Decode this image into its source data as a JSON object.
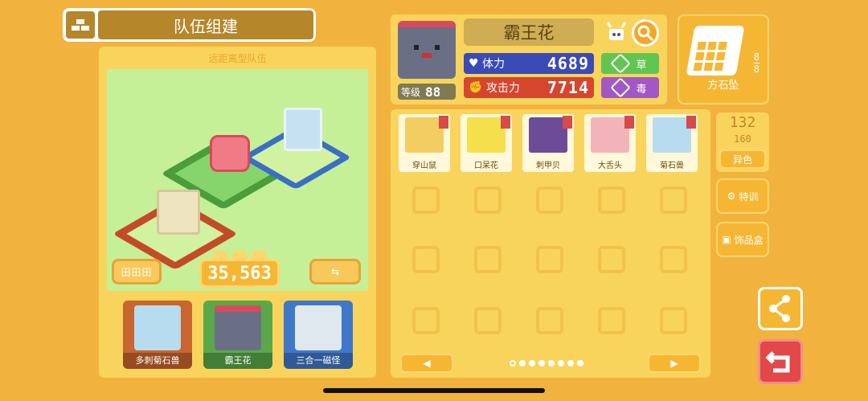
{
  "header": {
    "title": "队伍组建",
    "icon": "party-icon"
  },
  "team": {
    "subtitle": "远距离型队伍",
    "power": "35,563",
    "formation_label": "田田田",
    "swap_label": "⇆",
    "members": [
      {
        "name": "多刺菊石兽",
        "color": "#c9652f"
      },
      {
        "name": "霸王花",
        "color": "#5aa84a"
      },
      {
        "name": "三合一磁怪",
        "color": "#3f78c9"
      }
    ]
  },
  "detail": {
    "name": "霸王花",
    "level_label": "等级",
    "level": "88",
    "hp_label": "体力",
    "hp": "4689",
    "atk_label": "攻击力",
    "atk": "7714",
    "types": [
      "草",
      "毒"
    ]
  },
  "stones": {
    "label": "方石坠",
    "current": "8",
    "max": "8"
  },
  "box": {
    "cards": [
      {
        "name": "穿山鼠",
        "color": "#f2cd62"
      },
      {
        "name": "口呆花",
        "color": "#f5df4a"
      },
      {
        "name": "刺甲贝",
        "color": "#6c4c98"
      },
      {
        "name": "大舌头",
        "color": "#f2b4b8"
      },
      {
        "name": "菊石兽",
        "color": "#b8dcef"
      }
    ],
    "prev_label": "◀",
    "next_label": "▶"
  },
  "count": {
    "current": "132",
    "max": "160",
    "shiny_label": "异色"
  },
  "side": {
    "training_label": "特训",
    "decor_label": "饰品盒"
  }
}
